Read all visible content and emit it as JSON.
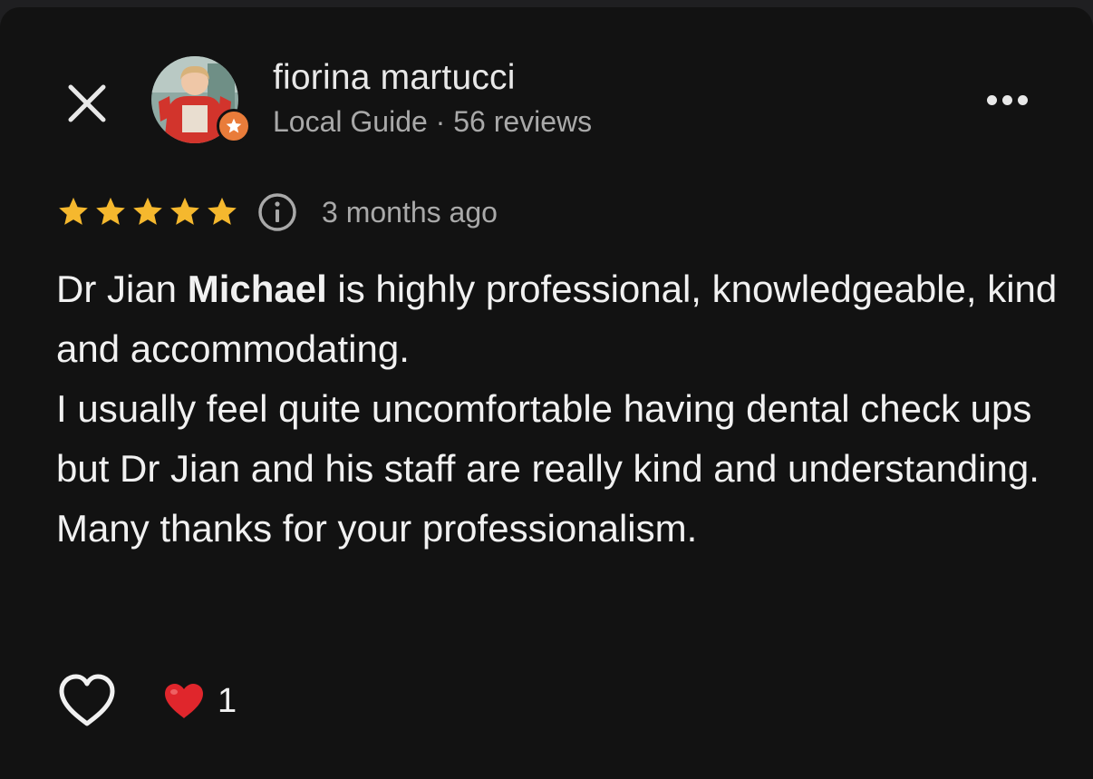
{
  "reviewer": {
    "name": "fiorina martucci",
    "meta": "Local Guide · 56 reviews",
    "avatar": "profile-photo",
    "badge_icon": "star-icon"
  },
  "review": {
    "rating": 5,
    "rating_max": 5,
    "time": "3 months ago",
    "text_prefix": "Dr Jian ",
    "text_highlight": "Michael",
    "text_suffix": " is highly professional, knowledgeable, kind and accommodating.",
    "paragraphs": [
      "I usually feel quite uncomfortable having dental check ups but Dr Jian and his staff are really kind and understanding.",
      "Many thanks for your professionalism."
    ]
  },
  "reactions": {
    "like_icon": "heart-outline-icon",
    "reaction_icon": "red-heart-icon",
    "count": "1"
  },
  "icons": {
    "close": "close-icon",
    "more": "more-options-icon",
    "info": "info-icon"
  },
  "colors": {
    "background": "#121212",
    "star": "#f5b82e",
    "badge": "#e97c3a",
    "text_primary": "#f1f1f1",
    "text_secondary": "#a9a9a9",
    "heart": "#e0262c"
  }
}
